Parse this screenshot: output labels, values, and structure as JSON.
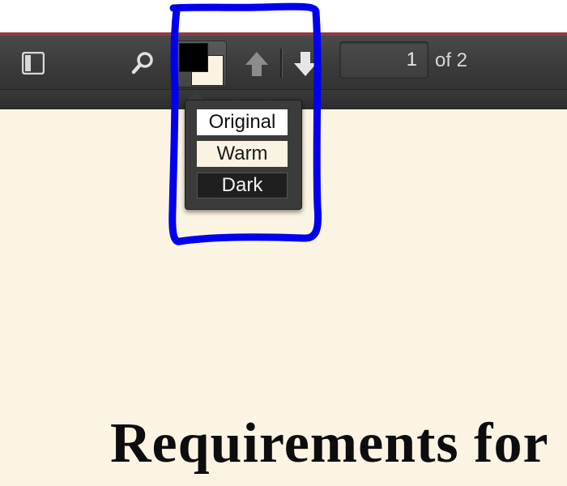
{
  "colors": {
    "accent_line": "#8f3a43",
    "page_background": "#fcf4e2",
    "annotation_stroke": "#0000ee"
  },
  "toolbar": {
    "sidebar_toggle_icon": "sidebar-toggle-icon",
    "search_icon": "search-icon",
    "theme_button_icon": "color-theme-icon",
    "prev_icon": "arrow-up-icon",
    "next_icon": "arrow-down-icon",
    "page_number": "1",
    "page_total_label": "of 2"
  },
  "theme_menu": {
    "options": [
      {
        "label": "Original",
        "bg": "#ffffff"
      },
      {
        "label": "Warm",
        "bg": "#fbf3e1"
      },
      {
        "label": "Dark",
        "bg": "#1f1f1f"
      }
    ]
  },
  "document": {
    "title_fragment": "Requirements for"
  }
}
